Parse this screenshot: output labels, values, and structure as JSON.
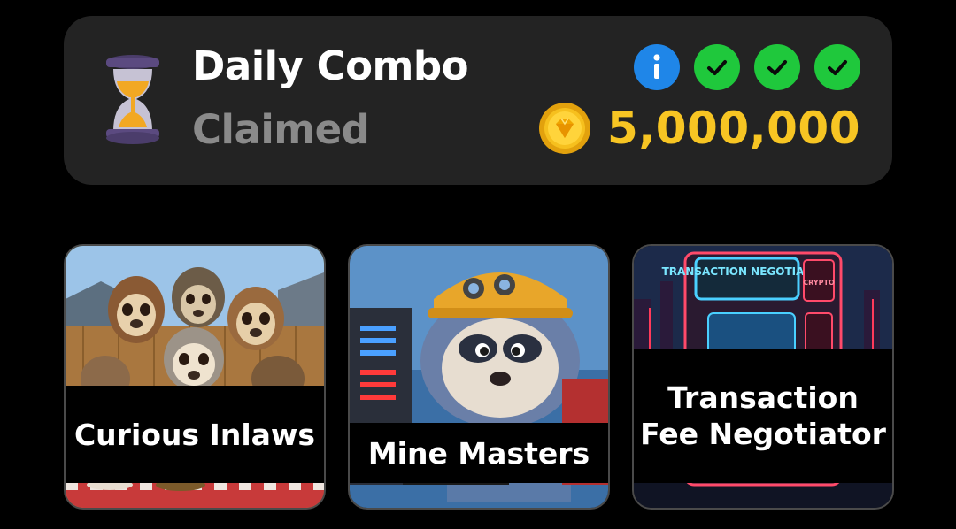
{
  "daily_combo": {
    "title": "Daily Combo",
    "status": "Claimed",
    "badges": [
      {
        "icon": "info-icon",
        "color": "#1f86e8"
      },
      {
        "icon": "check-icon",
        "color": "#1fc83c"
      },
      {
        "icon": "check-icon",
        "color": "#1fc83c"
      },
      {
        "icon": "check-icon",
        "color": "#1fc83c"
      }
    ],
    "reward": {
      "icon": "gold-coin-icon",
      "amount": "5,000,000",
      "color": "#f7c523"
    }
  },
  "cards": [
    {
      "title": "Curious Inlaws",
      "image": "sloth-family-image"
    },
    {
      "title": "Mine Masters",
      "image": "sloth-miner-image"
    },
    {
      "title": "Transaction Fee Negotiator",
      "image": "transaction-negotiation-machine-image",
      "image_text_1": "TRANSACTION NEGOTIATION",
      "image_text_2": "CRYPTO"
    }
  ]
}
